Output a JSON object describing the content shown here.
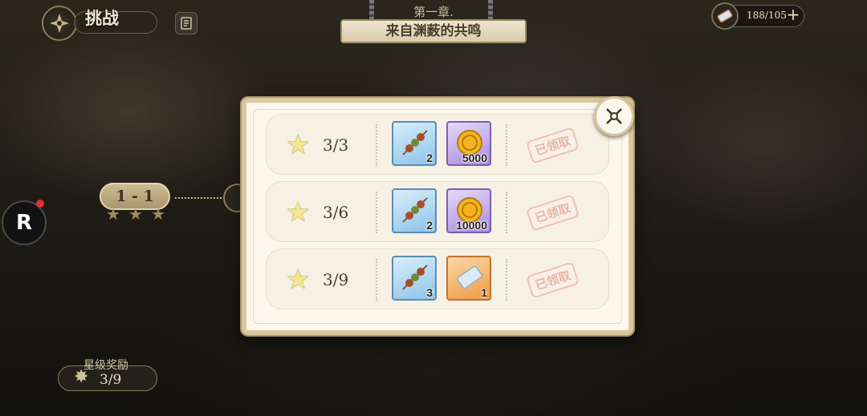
{
  "header": {
    "title": "挑战",
    "back_icon": "compass-back-icon",
    "doc_icon": "document-icon"
  },
  "chapter": {
    "number": "第一章.",
    "name": "来自渊薮的共鸣"
  },
  "resource": {
    "icon": "ticket-icon",
    "value": "188/105",
    "add_label": "+"
  },
  "map": {
    "stage_label": "1 - 1",
    "stage_stars": [
      "★",
      "★",
      "★"
    ]
  },
  "side": {
    "r_button_label": "R"
  },
  "star_reward": {
    "label": "星级奖励",
    "value": "3/9"
  },
  "modal": {
    "rows": [
      {
        "progress": "3/3",
        "items": [
          {
            "icon": "skewer-icon",
            "qty": "2",
            "rarity": "blue"
          },
          {
            "icon": "gold-coin-icon",
            "qty": "5000",
            "rarity": "purple"
          }
        ],
        "status": "已领取"
      },
      {
        "progress": "3/6",
        "items": [
          {
            "icon": "skewer-icon",
            "qty": "2",
            "rarity": "blue"
          },
          {
            "icon": "gold-coin-icon",
            "qty": "10000",
            "rarity": "purple"
          }
        ],
        "status": "已领取"
      },
      {
        "progress": "3/9",
        "items": [
          {
            "icon": "skewer-icon",
            "qty": "3",
            "rarity": "blue"
          },
          {
            "icon": "ticket-icon",
            "qty": "1",
            "rarity": "orange"
          }
        ],
        "status": "已领取"
      }
    ]
  },
  "colors": {
    "modal_bg": "#fbf7ec",
    "modal_border": "#d9c89f",
    "stamp": "#e9b7a8",
    "star": "#f4e68e"
  }
}
